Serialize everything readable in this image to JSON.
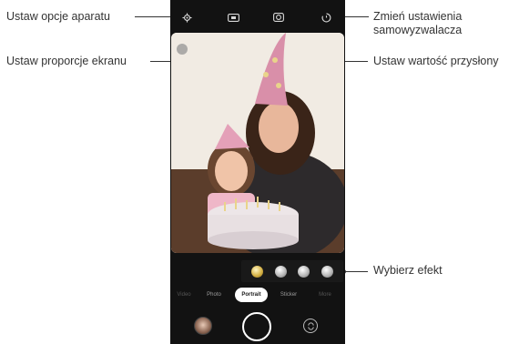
{
  "callouts": {
    "settings": "Ustaw opcje aparatu",
    "aspect_ratio": "Ustaw proporcje ekranu",
    "timer_line1": "Zmień ustawienia",
    "timer_line2": "samowyzwalacza",
    "aperture": "Ustaw wartość przysłony",
    "effect": "Wybierz efekt"
  },
  "camera": {
    "top_icons": [
      "gear-icon",
      "aspect-ratio-icon",
      "aperture-icon",
      "timer-icon"
    ],
    "effects": [
      {
        "icon": "effect-icon",
        "selected": true
      },
      {
        "icon": "effect-icon",
        "selected": false
      },
      {
        "icon": "effect-icon",
        "selected": false
      },
      {
        "icon": "effect-icon",
        "selected": false
      }
    ],
    "modes": [
      "Video",
      "Photo",
      "Portrait",
      "Sticker",
      "More"
    ],
    "active_mode": "Portrait",
    "bottom_icons": [
      "gallery-thumbnail",
      "shutter-button",
      "switch-camera-icon"
    ]
  },
  "colors": {
    "callout_line": "#333333",
    "phone_bg": "#121212",
    "mode_active_bg": "#ffffff"
  }
}
